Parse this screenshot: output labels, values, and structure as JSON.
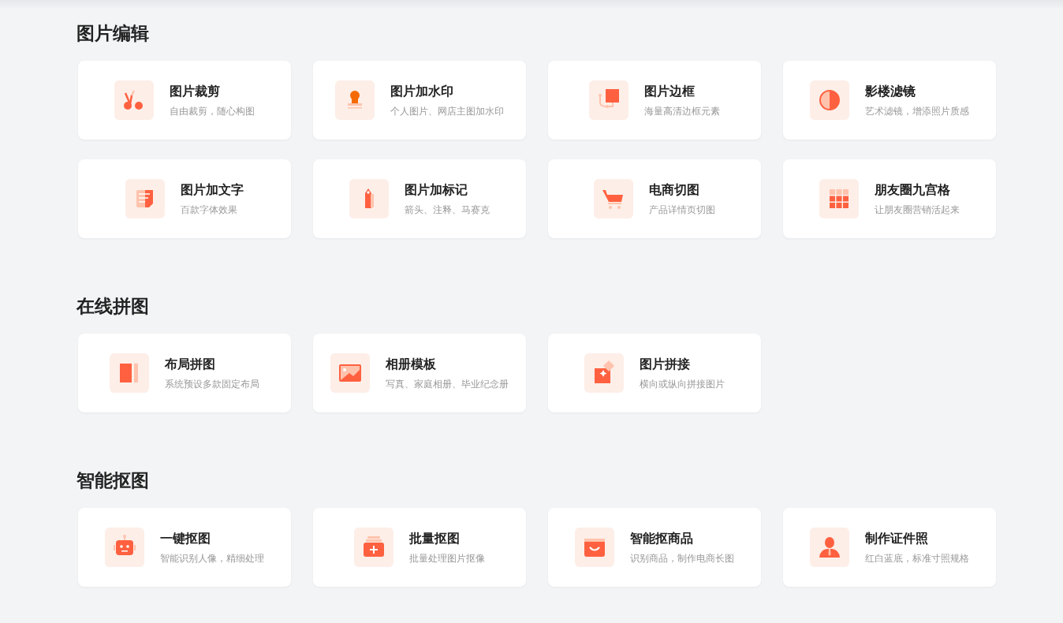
{
  "sections": [
    {
      "title": "图片编辑",
      "tools": [
        {
          "title": "图片裁剪",
          "description": "自由裁剪，随心构图"
        },
        {
          "title": "图片加水印",
          "description": "个人图片、网店主图加水印"
        },
        {
          "title": "图片边框",
          "description": "海量高清边框元素"
        },
        {
          "title": "影楼滤镜",
          "description": "艺术滤镜，增添照片质感"
        },
        {
          "title": "图片加文字",
          "description": "百款字体效果"
        },
        {
          "title": "图片加标记",
          "description": "箭头、注释、马赛克"
        },
        {
          "title": "电商切图",
          "description": "产品详情页切图"
        },
        {
          "title": "朋友圈九宫格",
          "description": "让朋友圈营销活起来"
        }
      ]
    },
    {
      "title": "在线拼图",
      "tools": [
        {
          "title": "布局拼图",
          "description": "系统预设多款固定布局"
        },
        {
          "title": "相册模板",
          "description": "写真、家庭相册、毕业纪念册"
        },
        {
          "title": "图片拼接",
          "description": "横向或纵向拼接图片"
        }
      ]
    },
    {
      "title": "智能抠图",
      "tools": [
        {
          "title": "一键抠图",
          "description": "智能识别人像，精细处理"
        },
        {
          "title": "批量抠图",
          "description": "批量处理图片抠像"
        },
        {
          "title": "智能抠商品",
          "description": "识别商品，制作电商长图"
        },
        {
          "title": "制作证件照",
          "description": "红白蓝底，标准寸照规格"
        }
      ]
    }
  ]
}
